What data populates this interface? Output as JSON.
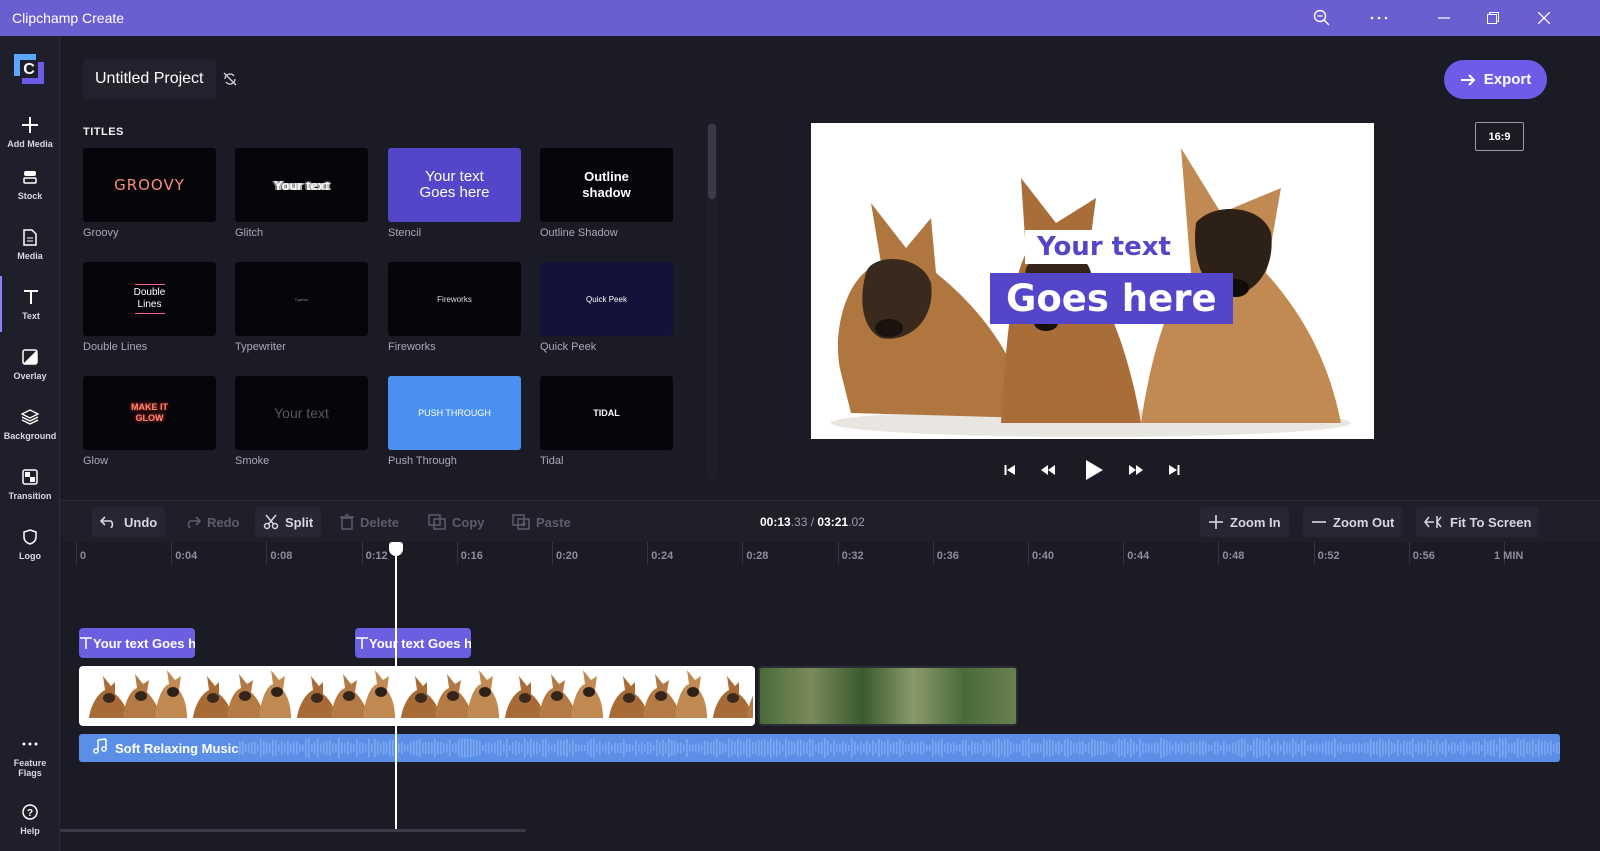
{
  "window": {
    "title": "Clipchamp Create",
    "buttons": [
      "search-icon",
      "more-icon",
      "minimize-icon",
      "restore-icon",
      "close-icon"
    ]
  },
  "rail": {
    "items": [
      {
        "id": "add-media",
        "label": "Add Media",
        "icon": "plus-icon"
      },
      {
        "id": "stock",
        "label": "Stock",
        "icon": "stock-icon"
      },
      {
        "id": "media",
        "label": "Media",
        "icon": "file-icon"
      },
      {
        "id": "text",
        "label": "Text",
        "icon": "text-icon",
        "active": true
      },
      {
        "id": "overlay",
        "label": "Overlay",
        "icon": "overlay-icon"
      },
      {
        "id": "background",
        "label": "Background",
        "icon": "layers-icon"
      },
      {
        "id": "transition",
        "label": "Transition",
        "icon": "transition-icon"
      },
      {
        "id": "logo",
        "label": "Logo",
        "icon": "shield-icon"
      }
    ],
    "bottom": [
      {
        "id": "feature-flags",
        "label": "Feature Flags",
        "label_line1": "Feature",
        "label_line2": "Flags",
        "icon": "more-icon"
      },
      {
        "id": "help",
        "label": "Help",
        "icon": "help-icon"
      }
    ]
  },
  "project": {
    "name": "Untitled Project"
  },
  "panel": {
    "heading": "TITLES",
    "tiles": [
      {
        "name": "Groovy",
        "thumb_text": "GROOVY"
      },
      {
        "name": "Glitch",
        "thumb_text": "Your text"
      },
      {
        "name": "Stencil",
        "thumb_text_1": "Your text",
        "thumb_text_2": "Goes here"
      },
      {
        "name": "Outline Shadow",
        "thumb_text_1": "Outline",
        "thumb_text_2": "shadow"
      },
      {
        "name": "Double Lines",
        "thumb_text_1": "Double",
        "thumb_text_2": "Lines"
      },
      {
        "name": "Typewriter",
        "thumb_text": "Typewri"
      },
      {
        "name": "Fireworks",
        "thumb_text": "Fireworks"
      },
      {
        "name": "Quick Peek",
        "thumb_text": "Quick Peek"
      },
      {
        "name": "Glow",
        "thumb_text_1": "MAKE IT",
        "thumb_text_2": "GLOW"
      },
      {
        "name": "Smoke",
        "thumb_text": "Your text"
      },
      {
        "name": "Push Through",
        "thumb_text": "PUSH THROUGH"
      },
      {
        "name": "Tidal",
        "thumb_text": "TIDAL"
      }
    ]
  },
  "export": {
    "label": "Export"
  },
  "aspect_ratio": "16:9",
  "preview": {
    "line1": "Your text",
    "line2": "Goes here"
  },
  "toolbar": {
    "undo": "Undo",
    "redo": "Redo",
    "split": "Split",
    "delete": "Delete",
    "copy": "Copy",
    "paste": "Paste",
    "zoom_in": "Zoom In",
    "zoom_out": "Zoom Out",
    "fit": "Fit To Screen"
  },
  "timecode": {
    "current_main": "00:13",
    "current_frac": ".33",
    "sep": " / ",
    "total_main": "03:21",
    "total_frac": ".02"
  },
  "ruler": [
    "0",
    "0:04",
    "0:08",
    "0:12",
    "0:16",
    "0:20",
    "0:24",
    "0:28",
    "0:32",
    "0:36",
    "0:40",
    "0:44",
    "0:48",
    "0:52",
    "0:56",
    "1 MIN"
  ],
  "tracks": {
    "text_clips": [
      "Your text Goes here",
      "Your text Goes here"
    ],
    "audio": "Soft Relaxing Music"
  },
  "colors": {
    "accent": "#6c5ce7",
    "titlebar": "#6a5fd0",
    "audio": "#5b8ee6",
    "text_clip": "#6a5fe0"
  }
}
